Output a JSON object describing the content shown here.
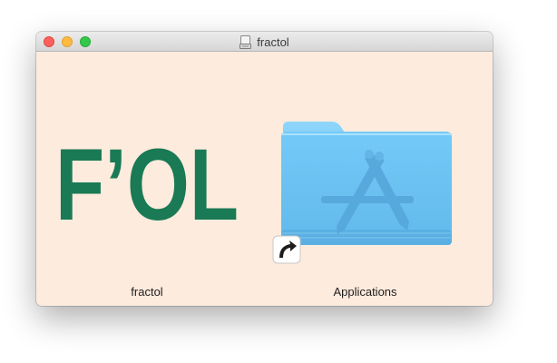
{
  "window": {
    "title": "fractol"
  },
  "items": [
    {
      "label": "fractol",
      "icon": "app-logo-icon",
      "logo_text": "F’OL"
    },
    {
      "label": "Applications",
      "icon": "applications-folder-icon"
    }
  ],
  "colors": {
    "window_background": "#fdebdd",
    "logo_green": "#197a55",
    "folder_blue": "#6fc8f5"
  }
}
